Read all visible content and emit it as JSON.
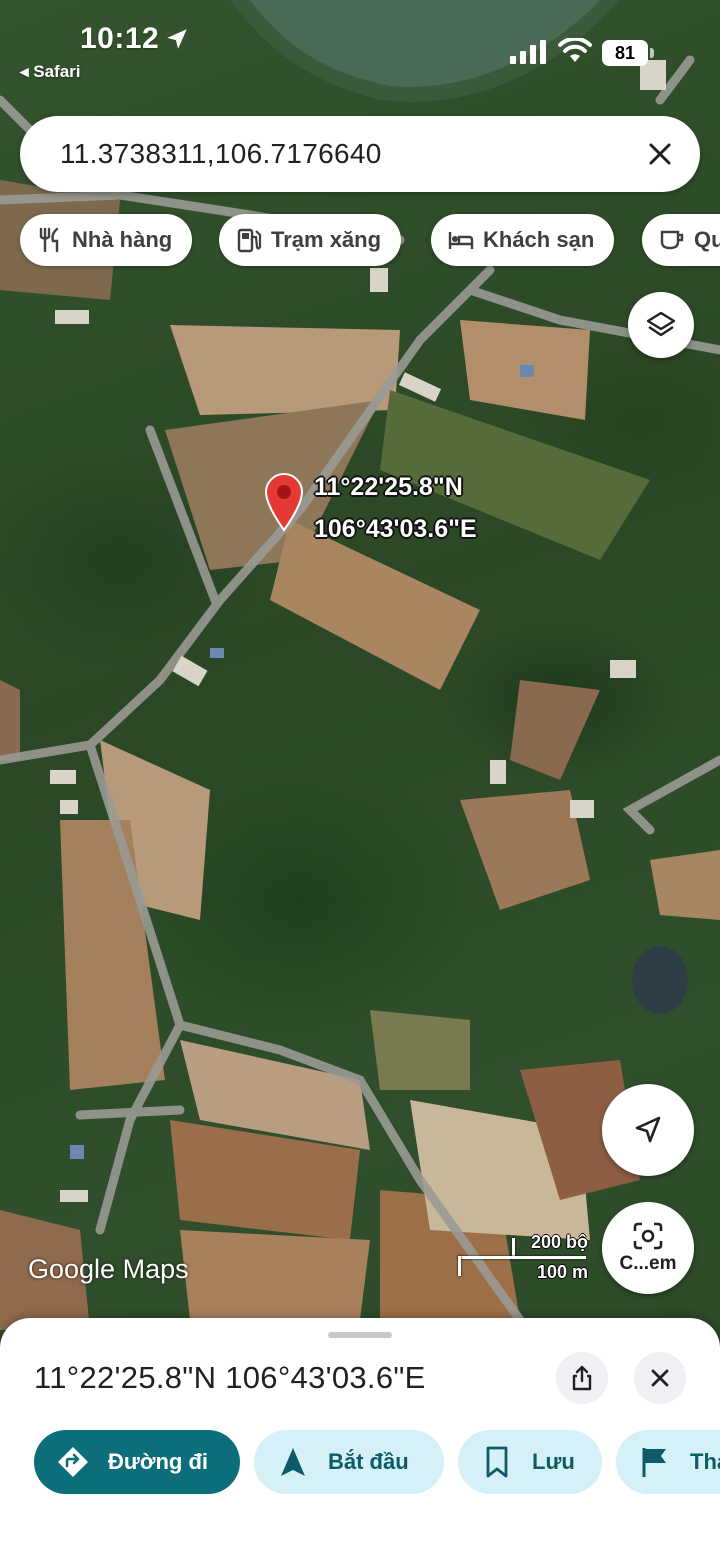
{
  "status_bar": {
    "time": "10:12",
    "back_app": "◂ Safari",
    "battery": "81"
  },
  "search": {
    "value": "11.3738311,106.7176640"
  },
  "chips": [
    {
      "label": "Nhà hàng",
      "icon": "restaurant-icon"
    },
    {
      "label": "Trạm xăng",
      "icon": "gas-station-icon"
    },
    {
      "label": "Khách sạn",
      "icon": "hotel-icon"
    },
    {
      "label": "Qu",
      "icon": "coffee-icon"
    }
  ],
  "map": {
    "pin_label_line1": "11°22'25.8\"N",
    "pin_label_line2": "106°43'03.6\"E",
    "watermark_google": "Google",
    "watermark_maps": " Maps",
    "scale_top": "200 bộ",
    "scale_bottom": "100 m",
    "lens_label": "C...em"
  },
  "sheet": {
    "title": "11°22'25.8\"N 106°43'03.6\"E",
    "actions": [
      {
        "label": "Đường đi",
        "icon": "directions-icon"
      },
      {
        "label": "Bắt đầu",
        "icon": "navigate-icon"
      },
      {
        "label": "Lưu",
        "icon": "bookmark-icon"
      },
      {
        "label": "Thả",
        "icon": "flag-icon"
      }
    ]
  },
  "colors": {
    "primary": "#0b6e7a",
    "secondary_bg": "#d6f0f8",
    "pin": "#e53935"
  }
}
